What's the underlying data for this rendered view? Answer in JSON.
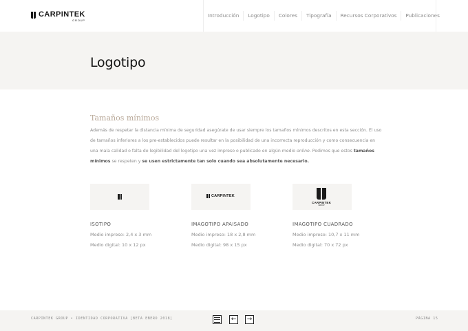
{
  "header": {
    "brand_name": "CARPINTEK",
    "brand_sub": "GROUP",
    "nav": [
      "Introducción",
      "Logotipo",
      "Colores",
      "Tipografía",
      "Recursos Corporativos",
      "Publicaciones"
    ]
  },
  "hero": {
    "title": "Logotipo"
  },
  "section": {
    "title": "Tamaños mínimos",
    "p1": "Además de respetar la distancia mínima de seguridad asegúrate de usar siempre los tamaños mínimos descritos en esta sección. El uso de tamaños inferiores a los pre-establecidos puede resultar en la posibilidad de una incorrecta reproducción y como consecuencia en una mala calidad o falta de legibilidad del logotipo una vez impreso o publicado en algún medio ",
    "p1_em": "online",
    "p1_tail": ". Pedimos que estos ",
    "p1_bold1": "tamaños mínimos",
    "p1_mid": " se respeten y ",
    "p1_bold2": "se usen estrictamente tan solo cuando sea absolutamente necesario."
  },
  "cards": [
    {
      "title": "ISOTIPO",
      "print": "Medio impreso: 2,4 x 3 mm",
      "digital": "Medio digital: 10 x 12 px"
    },
    {
      "title": "IMAGOTIPO APAISADO",
      "print": "Medio impreso: 18 x 2,8 mm",
      "digital": "Medio digital: 98 x 15 px",
      "logo_text": "CARPINTEK"
    },
    {
      "title": "IMAGOTIPO CUADRADO",
      "print": "Medio impreso: 10,7 x 11 mm",
      "digital": "Medio digital: 70 x 72 px",
      "logo_text": "CARPINTEK",
      "logo_sub": "GROUP"
    }
  ],
  "footer": {
    "left": "CARPINTEK GROUP • IDENTIDAD CORPORATIVA [BETA ENERO 2018]",
    "right": "PÁGINA 15",
    "prev_icon": "arrow-left-icon",
    "next_icon": "arrow-right-icon",
    "index_icon": "list-icon"
  }
}
